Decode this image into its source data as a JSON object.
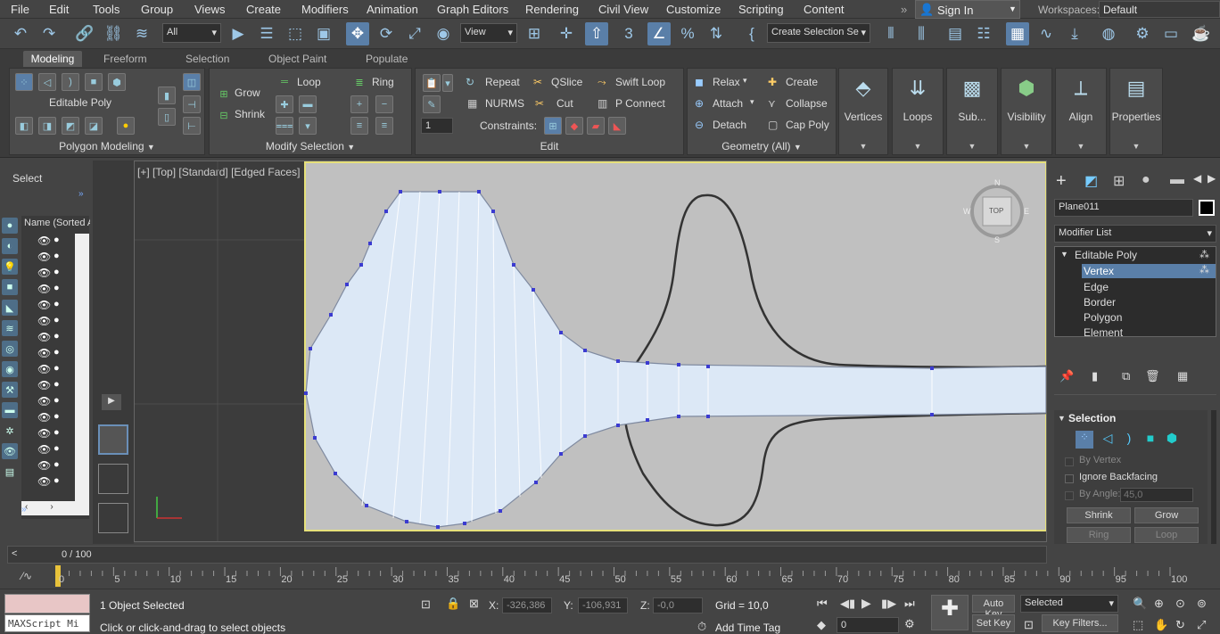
{
  "menu": [
    "File",
    "Edit",
    "Tools",
    "Group",
    "Views",
    "Create",
    "Modifiers",
    "Animation",
    "Graph Editors",
    "Rendering",
    "Civil View",
    "Customize",
    "Scripting",
    "Content"
  ],
  "signin": {
    "label": "Sign In",
    "arrow": "▼"
  },
  "workspaces": {
    "label": "Workspaces:",
    "value": "Default"
  },
  "toolbar": {
    "filter": "All",
    "refcoord": "View",
    "selset": "Create Selection Se",
    "more_icon": "»"
  },
  "ribbon": {
    "tabs": [
      "Modeling",
      "Freeform",
      "Selection",
      "Object Paint",
      "Populate"
    ],
    "editable_poly": "Editable Poly",
    "polygon_modeling": "Polygon Modeling",
    "modify_selection": "Modify Selection",
    "grow": "Grow",
    "shrink": "Shrink",
    "loop": "Loop",
    "ring": "Ring",
    "edit": "Edit",
    "repeat": "Repeat",
    "qslice": "QSlice",
    "swift_loop": "Swift Loop",
    "nurms": "NURMS",
    "cut": "Cut",
    "p_connect": "P Connect",
    "constraints": "Constraints:",
    "geometry": "Geometry (All)",
    "relax": "Relax",
    "create": "Create",
    "attach": "Attach",
    "collapse": "Collapse",
    "detach": "Detach",
    "cap_poly": "Cap Poly",
    "spinner": "1",
    "big": [
      "Vertices",
      "Loops",
      "Sub...",
      "Visibility",
      "Align",
      "Properties"
    ]
  },
  "left": {
    "select": "Select",
    "scene_header": "Name (Sorted A"
  },
  "viewport": {
    "label": "[+] [Top] [Standard] [Edged Faces]",
    "cube": "TOP",
    "compass": [
      "N",
      "W",
      "E",
      "S"
    ]
  },
  "command": {
    "object_name": "Plane011",
    "modifier_list": "Modifier List",
    "stack": [
      "Editable Poly",
      "Vertex",
      "Edge",
      "Border",
      "Polygon",
      "Element"
    ],
    "selection_title": "Selection",
    "by_vertex": "By Vertex",
    "ignore_backfacing": "Ignore Backfacing",
    "by_angle": "By Angle:",
    "angle_value": "45,0",
    "shrink": "Shrink",
    "grow": "Grow",
    "ring": "Ring",
    "loop": "Loop"
  },
  "timeline": {
    "frame": "0 / 100",
    "ticks": [
      "0",
      "5",
      "10",
      "15",
      "20",
      "25",
      "30",
      "35",
      "40",
      "45",
      "50",
      "55",
      "60",
      "65",
      "70",
      "75",
      "80",
      "85",
      "90",
      "95",
      "100"
    ]
  },
  "status": {
    "maxscript": "MAXScript Mi",
    "selected": "1 Object Selected",
    "prompt": "Click or click-and-drag to select objects",
    "x_label": "X:",
    "x": "-326,386",
    "y_label": "Y:",
    "y": "-106,931",
    "z_label": "Z:",
    "z": "-0,0",
    "grid": "Grid = 10,0",
    "add_time_tag": "Add Time Tag",
    "auto_key": "Auto Key",
    "set_key": "Set Key",
    "selected_dd": "Selected",
    "key_filters": "Key Filters...",
    "frame_value": "0"
  },
  "colors": {
    "accent": "#5a7fa8",
    "mesh": "#dce8f6",
    "vertex": "#3b3bd0",
    "viewport_bg": "#c0c0c0"
  }
}
